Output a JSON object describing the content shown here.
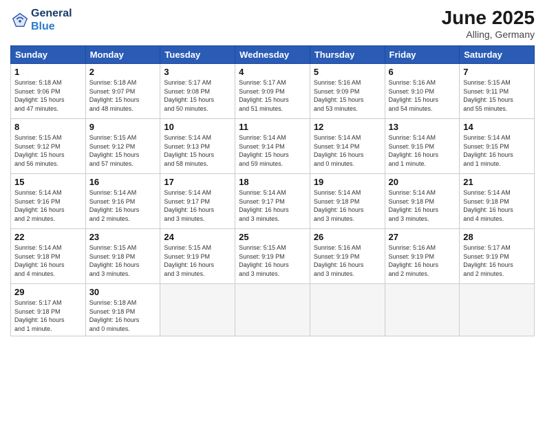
{
  "logo": {
    "line1": "General",
    "line2": "Blue"
  },
  "title": "June 2025",
  "subtitle": "Alling, Germany",
  "headers": [
    "Sunday",
    "Monday",
    "Tuesday",
    "Wednesday",
    "Thursday",
    "Friday",
    "Saturday"
  ],
  "weeks": [
    [
      {
        "day": "1",
        "info": "Sunrise: 5:18 AM\nSunset: 9:06 PM\nDaylight: 15 hours\nand 47 minutes."
      },
      {
        "day": "2",
        "info": "Sunrise: 5:18 AM\nSunset: 9:07 PM\nDaylight: 15 hours\nand 48 minutes."
      },
      {
        "day": "3",
        "info": "Sunrise: 5:17 AM\nSunset: 9:08 PM\nDaylight: 15 hours\nand 50 minutes."
      },
      {
        "day": "4",
        "info": "Sunrise: 5:17 AM\nSunset: 9:09 PM\nDaylight: 15 hours\nand 51 minutes."
      },
      {
        "day": "5",
        "info": "Sunrise: 5:16 AM\nSunset: 9:09 PM\nDaylight: 15 hours\nand 53 minutes."
      },
      {
        "day": "6",
        "info": "Sunrise: 5:16 AM\nSunset: 9:10 PM\nDaylight: 15 hours\nand 54 minutes."
      },
      {
        "day": "7",
        "info": "Sunrise: 5:15 AM\nSunset: 9:11 PM\nDaylight: 15 hours\nand 55 minutes."
      }
    ],
    [
      {
        "day": "8",
        "info": "Sunrise: 5:15 AM\nSunset: 9:12 PM\nDaylight: 15 hours\nand 56 minutes."
      },
      {
        "day": "9",
        "info": "Sunrise: 5:15 AM\nSunset: 9:12 PM\nDaylight: 15 hours\nand 57 minutes."
      },
      {
        "day": "10",
        "info": "Sunrise: 5:14 AM\nSunset: 9:13 PM\nDaylight: 15 hours\nand 58 minutes."
      },
      {
        "day": "11",
        "info": "Sunrise: 5:14 AM\nSunset: 9:14 PM\nDaylight: 15 hours\nand 59 minutes."
      },
      {
        "day": "12",
        "info": "Sunrise: 5:14 AM\nSunset: 9:14 PM\nDaylight: 16 hours\nand 0 minutes."
      },
      {
        "day": "13",
        "info": "Sunrise: 5:14 AM\nSunset: 9:15 PM\nDaylight: 16 hours\nand 1 minute."
      },
      {
        "day": "14",
        "info": "Sunrise: 5:14 AM\nSunset: 9:15 PM\nDaylight: 16 hours\nand 1 minute."
      }
    ],
    [
      {
        "day": "15",
        "info": "Sunrise: 5:14 AM\nSunset: 9:16 PM\nDaylight: 16 hours\nand 2 minutes."
      },
      {
        "day": "16",
        "info": "Sunrise: 5:14 AM\nSunset: 9:16 PM\nDaylight: 16 hours\nand 2 minutes."
      },
      {
        "day": "17",
        "info": "Sunrise: 5:14 AM\nSunset: 9:17 PM\nDaylight: 16 hours\nand 3 minutes."
      },
      {
        "day": "18",
        "info": "Sunrise: 5:14 AM\nSunset: 9:17 PM\nDaylight: 16 hours\nand 3 minutes."
      },
      {
        "day": "19",
        "info": "Sunrise: 5:14 AM\nSunset: 9:18 PM\nDaylight: 16 hours\nand 3 minutes."
      },
      {
        "day": "20",
        "info": "Sunrise: 5:14 AM\nSunset: 9:18 PM\nDaylight: 16 hours\nand 3 minutes."
      },
      {
        "day": "21",
        "info": "Sunrise: 5:14 AM\nSunset: 9:18 PM\nDaylight: 16 hours\nand 4 minutes."
      }
    ],
    [
      {
        "day": "22",
        "info": "Sunrise: 5:14 AM\nSunset: 9:18 PM\nDaylight: 16 hours\nand 4 minutes."
      },
      {
        "day": "23",
        "info": "Sunrise: 5:15 AM\nSunset: 9:18 PM\nDaylight: 16 hours\nand 3 minutes."
      },
      {
        "day": "24",
        "info": "Sunrise: 5:15 AM\nSunset: 9:19 PM\nDaylight: 16 hours\nand 3 minutes."
      },
      {
        "day": "25",
        "info": "Sunrise: 5:15 AM\nSunset: 9:19 PM\nDaylight: 16 hours\nand 3 minutes."
      },
      {
        "day": "26",
        "info": "Sunrise: 5:16 AM\nSunset: 9:19 PM\nDaylight: 16 hours\nand 3 minutes."
      },
      {
        "day": "27",
        "info": "Sunrise: 5:16 AM\nSunset: 9:19 PM\nDaylight: 16 hours\nand 2 minutes."
      },
      {
        "day": "28",
        "info": "Sunrise: 5:17 AM\nSunset: 9:19 PM\nDaylight: 16 hours\nand 2 minutes."
      }
    ],
    [
      {
        "day": "29",
        "info": "Sunrise: 5:17 AM\nSunset: 9:18 PM\nDaylight: 16 hours\nand 1 minute."
      },
      {
        "day": "30",
        "info": "Sunrise: 5:18 AM\nSunset: 9:18 PM\nDaylight: 16 hours\nand 0 minutes."
      },
      null,
      null,
      null,
      null,
      null
    ]
  ]
}
